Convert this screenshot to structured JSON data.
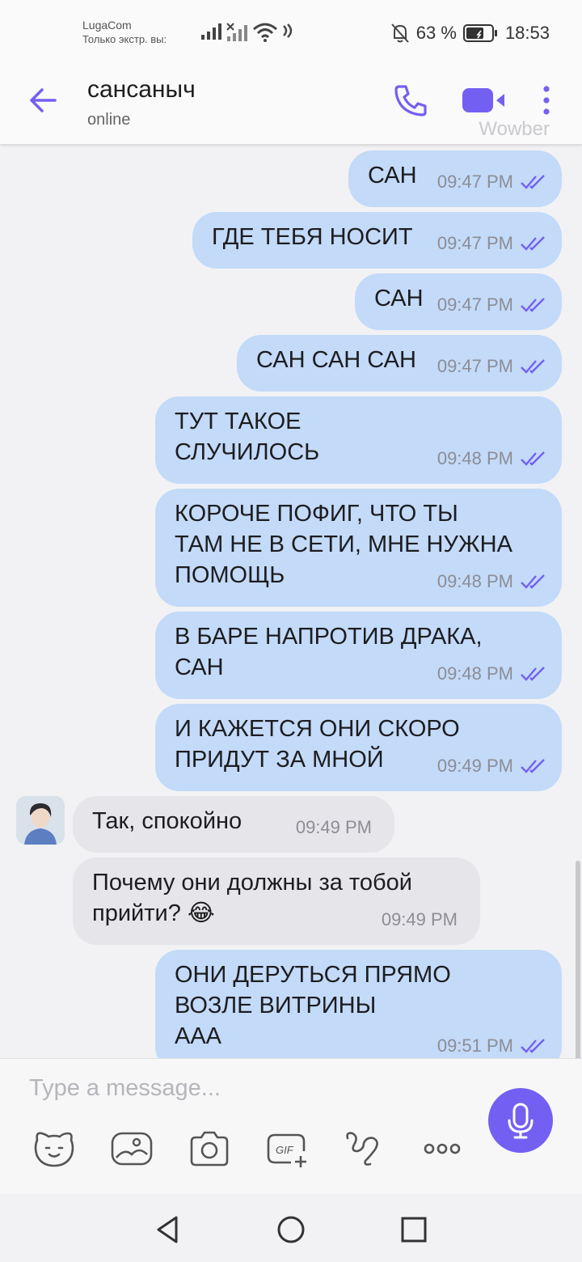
{
  "status_bar": {
    "carrier": "LugaCom",
    "carrier_note": "Только экстр. вы:",
    "battery": "63 %",
    "time": "18:53"
  },
  "header": {
    "contact_name": "сансаныч",
    "status": "online",
    "watermark": "Wowber",
    "back_icon": "arrow-left-icon",
    "call_icon": "phone-icon",
    "video_icon": "video-camera-icon",
    "more_icon": "more-vertical-icon",
    "accent": "#7360f2"
  },
  "messages": [
    {
      "dir": "out",
      "text": "САН",
      "time": "09:47 PM",
      "status": "read"
    },
    {
      "dir": "out",
      "text": "ГДЕ ТЕБЯ НОСИТ",
      "time": "09:47 PM",
      "status": "read"
    },
    {
      "dir": "out",
      "text": "САН",
      "time": "09:47 PM",
      "status": "read"
    },
    {
      "dir": "out",
      "text": "САН САН САН",
      "time": "09:47 PM",
      "status": "read"
    },
    {
      "dir": "out",
      "text": "ТУТ ТАКОЕ\nСЛУЧИЛОСЬ",
      "time": "09:48 PM",
      "status": "read"
    },
    {
      "dir": "out",
      "text": "КОРОЧЕ ПОФИГ, ЧТО ТЫ\nТАМ НЕ В СЕТИ, МНЕ НУЖНА\nПОМОЩЬ",
      "time": "09:48 PM",
      "status": "read"
    },
    {
      "dir": "out",
      "text": "В БАРЕ НАПРОТИВ ДРАКА,\nСАН",
      "time": "09:48 PM",
      "status": "read"
    },
    {
      "dir": "out",
      "text": "И КАЖЕТСЯ ОНИ СКОРО\nПРИДУТ ЗА МНОЙ",
      "time": "09:49 PM",
      "status": "read"
    },
    {
      "dir": "in",
      "text": "Так, спокойно",
      "time": "09:49 PM"
    },
    {
      "dir": "in",
      "text": "Почему они должны за тобой\nприйти? 😂",
      "time": "09:49 PM"
    },
    {
      "dir": "out",
      "text": "ОНИ ДЕРУТЬСЯ ПРЯМО\nВОЗЛЕ ВИТРИНЫ\nААА",
      "time": "09:51 PM",
      "status": "read"
    }
  ],
  "composer": {
    "placeholder": "Type a message...",
    "mic_icon": "microphone-icon",
    "tools": [
      "sticker-icon",
      "gallery-icon",
      "camera-icon",
      "gif-icon",
      "doodle-icon",
      "more-horizontal-icon"
    ]
  },
  "nav": [
    "back-triangle-icon",
    "home-circle-icon",
    "recents-square-icon"
  ],
  "colors": {
    "outgoing_bubble": "#c3daf9",
    "incoming_bubble": "#e6e6ea",
    "read_ticks": "#7360f2",
    "chat_background": "#f2f2f4"
  }
}
